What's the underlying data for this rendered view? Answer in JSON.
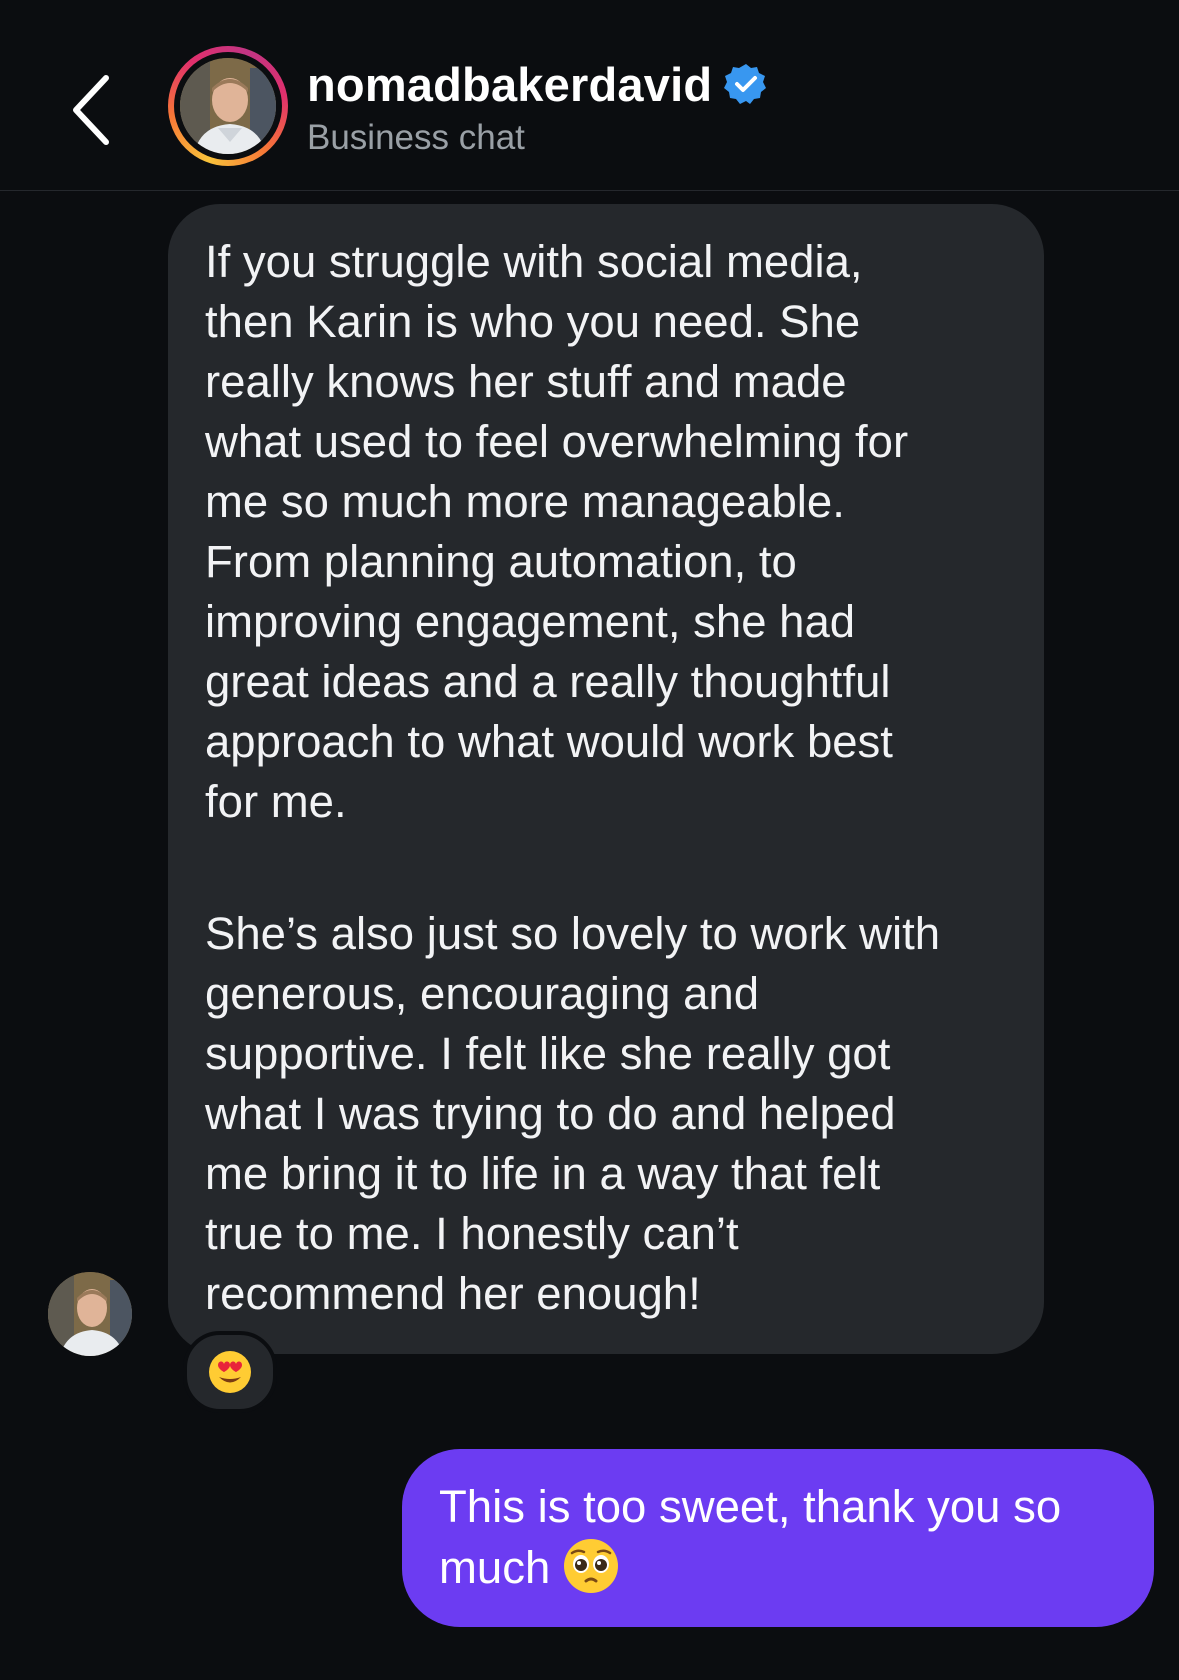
{
  "header": {
    "back_icon": "chevron-left-icon",
    "username": "nomadbakerdavid",
    "verified_icon": "verified-badge-icon",
    "subtitle": "Business chat"
  },
  "messages": {
    "received": {
      "paragraph_1": "If you struggle with social media,\nthen Karin is who you need. She\nreally knows her stuff and made\nwhat used to feel overwhelming for\nme so much more manageable.\nFrom planning automation, to\nimproving engagement, she had\ngreat ideas and a really thoughtful\napproach to what would work best\nfor me.",
      "paragraph_2": "She’s also just so lovely to work with\ngenerous, encouraging and\nsupportive. I felt like she really got\nwhat I was trying to do and helped\nme bring it to life in a way that felt\ntrue to me. I honestly can’t\nrecommend her enough!",
      "reaction": "heart-eyes-emoji"
    },
    "sent": {
      "text": "This is too sweet, thank you so\nmuch",
      "emoji": "pleading-face-emoji"
    }
  },
  "colors": {
    "background": "#0b0d10",
    "received_bubble": "#25282c",
    "sent_bubble": "#6c3cf2",
    "verified_blue": "#3897f0"
  }
}
